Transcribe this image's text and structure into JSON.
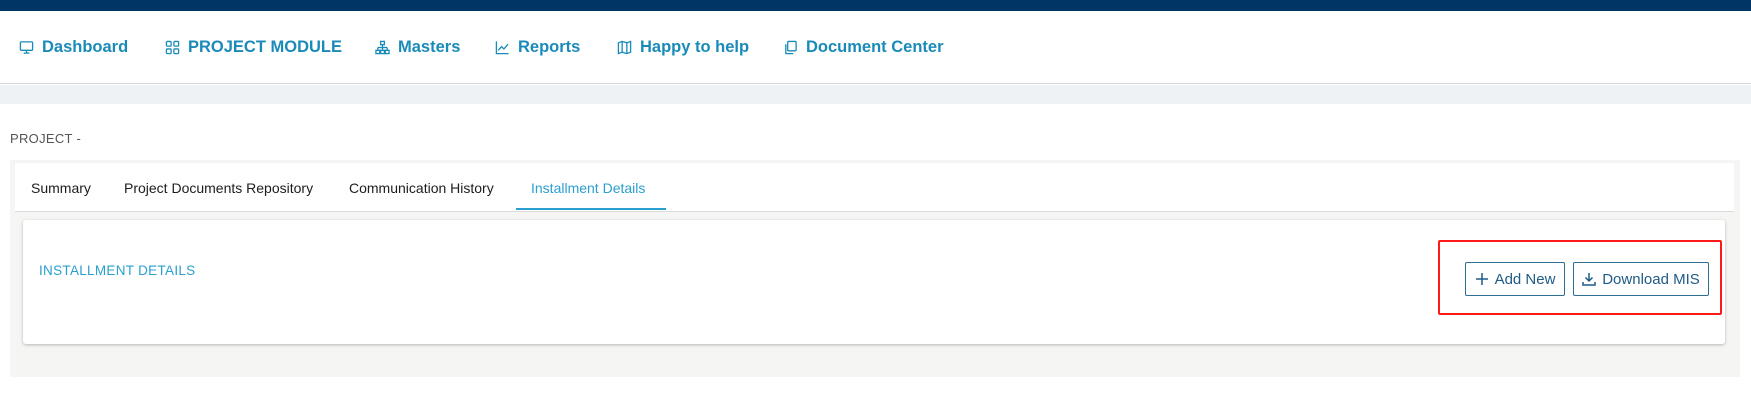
{
  "nav": {
    "items": [
      {
        "label": "Dashboard",
        "icon": "monitor-icon"
      },
      {
        "label": "PROJECT MODULE",
        "icon": "grid-icon"
      },
      {
        "label": "Masters",
        "icon": "hierarchy-icon"
      },
      {
        "label": "Reports",
        "icon": "chart-line-icon"
      },
      {
        "label": "Happy to help",
        "icon": "map-icon"
      },
      {
        "label": "Document Center",
        "icon": "documents-icon"
      }
    ]
  },
  "page": {
    "project_label": "PROJECT -"
  },
  "tabs": [
    {
      "label": "Summary",
      "active": false
    },
    {
      "label": "Project Documents Repository",
      "active": false
    },
    {
      "label": "Communication History",
      "active": false
    },
    {
      "label": "Installment Details",
      "active": true
    }
  ],
  "card": {
    "title": "INSTALLMENT DETAILS",
    "add_new_label": "Add New",
    "download_mis_label": "Download MIS"
  },
  "colors": {
    "topbar": "#003566",
    "nav_text": "#1a8bb8",
    "active_tab": "#2a9fd0",
    "button_border": "#2e6d95",
    "highlight": "#ff1a1a"
  }
}
